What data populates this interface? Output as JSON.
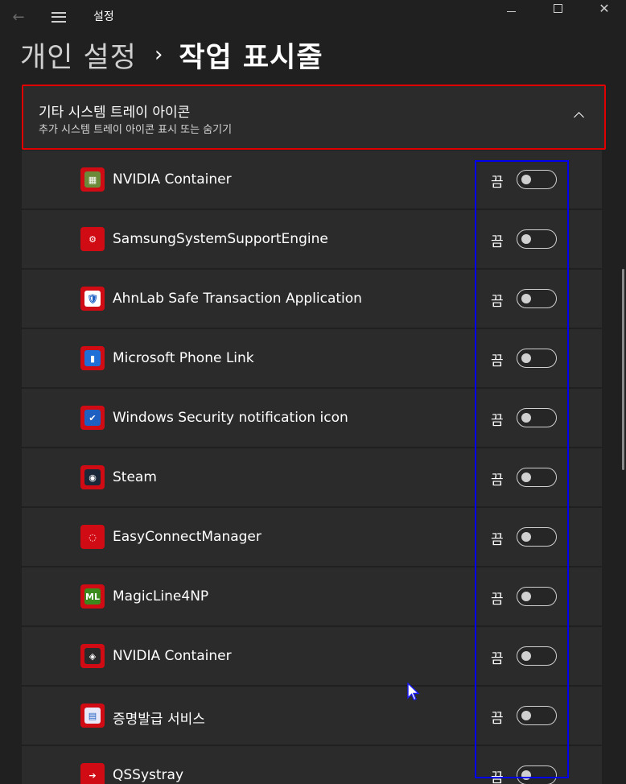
{
  "window": {
    "app_title": "설정",
    "back_icon": "back-arrow-icon",
    "menu_icon": "hamburger-menu-icon"
  },
  "breadcrumb": {
    "parent": "개인 설정",
    "separator": "›",
    "current": "작업 표시줄"
  },
  "section": {
    "title": "기타 시스템 트레이 아이콘",
    "subtitle": "추가 시스템 트레이 아이콘 표시 또는 숨기기",
    "expanded": true
  },
  "items": [
    {
      "name": "NVIDIA Container",
      "state": "끔",
      "on": false,
      "icon": "nvidia-container-icon",
      "glyph": "▦",
      "icon_bg": "#d10b14",
      "inner_bg": "#6b8a3a"
    },
    {
      "name": "SamsungSystemSupportEngine",
      "state": "끔",
      "on": false,
      "icon": "gear-icon",
      "glyph": "⚙",
      "icon_bg": "#d10b14",
      "inner_bg": "#d10b14"
    },
    {
      "name": "AhnLab Safe Transaction Application",
      "state": "끔",
      "on": false,
      "icon": "shield-icon",
      "glyph": "🛡",
      "icon_bg": "#d10b14",
      "inner_bg": "#ffffff"
    },
    {
      "name": "Microsoft Phone Link",
      "state": "끔",
      "on": false,
      "icon": "phone-link-icon",
      "glyph": "▮",
      "icon_bg": "#d10b14",
      "inner_bg": "#1f6fd6"
    },
    {
      "name": "Windows Security notification icon",
      "state": "끔",
      "on": false,
      "icon": "windows-security-icon",
      "glyph": "✔",
      "icon_bg": "#d10b14",
      "inner_bg": "#1e5fc2"
    },
    {
      "name": "Steam",
      "state": "끔",
      "on": false,
      "icon": "steam-icon",
      "glyph": "◉",
      "icon_bg": "#d10b14",
      "inner_bg": "#1b2838"
    },
    {
      "name": "EasyConnectManager",
      "state": "끔",
      "on": false,
      "icon": "easyconnect-icon",
      "glyph": "◌",
      "icon_bg": "#d10b14",
      "inner_bg": "#d10b14"
    },
    {
      "name": "MagicLine4NP",
      "state": "끔",
      "on": false,
      "icon": "magicline-icon",
      "glyph": "ML",
      "icon_bg": "#d10b14",
      "inner_bg": "#3a8a1e"
    },
    {
      "name": "NVIDIA Container",
      "state": "끔",
      "on": false,
      "icon": "nvidia-logo-icon",
      "glyph": "◈",
      "icon_bg": "#d10b14",
      "inner_bg": "#2a2a2a"
    },
    {
      "name": "증명발급 서비스",
      "state": "끔",
      "on": false,
      "icon": "certificate-service-icon",
      "glyph": "▤",
      "icon_bg": "#d10b14",
      "inner_bg": "#e8e8f8"
    },
    {
      "name": "QSSystray",
      "state": "끔",
      "on": false,
      "icon": "qssystray-icon",
      "glyph": "➔",
      "icon_bg": "#d10b14",
      "inner_bg": "#d10b14"
    }
  ],
  "colors": {
    "background": "#202020",
    "card": "#2b2b2b",
    "red_highlight": "#e00000",
    "blue_highlight": "#0000ee",
    "icon_red": "#d10b14"
  }
}
